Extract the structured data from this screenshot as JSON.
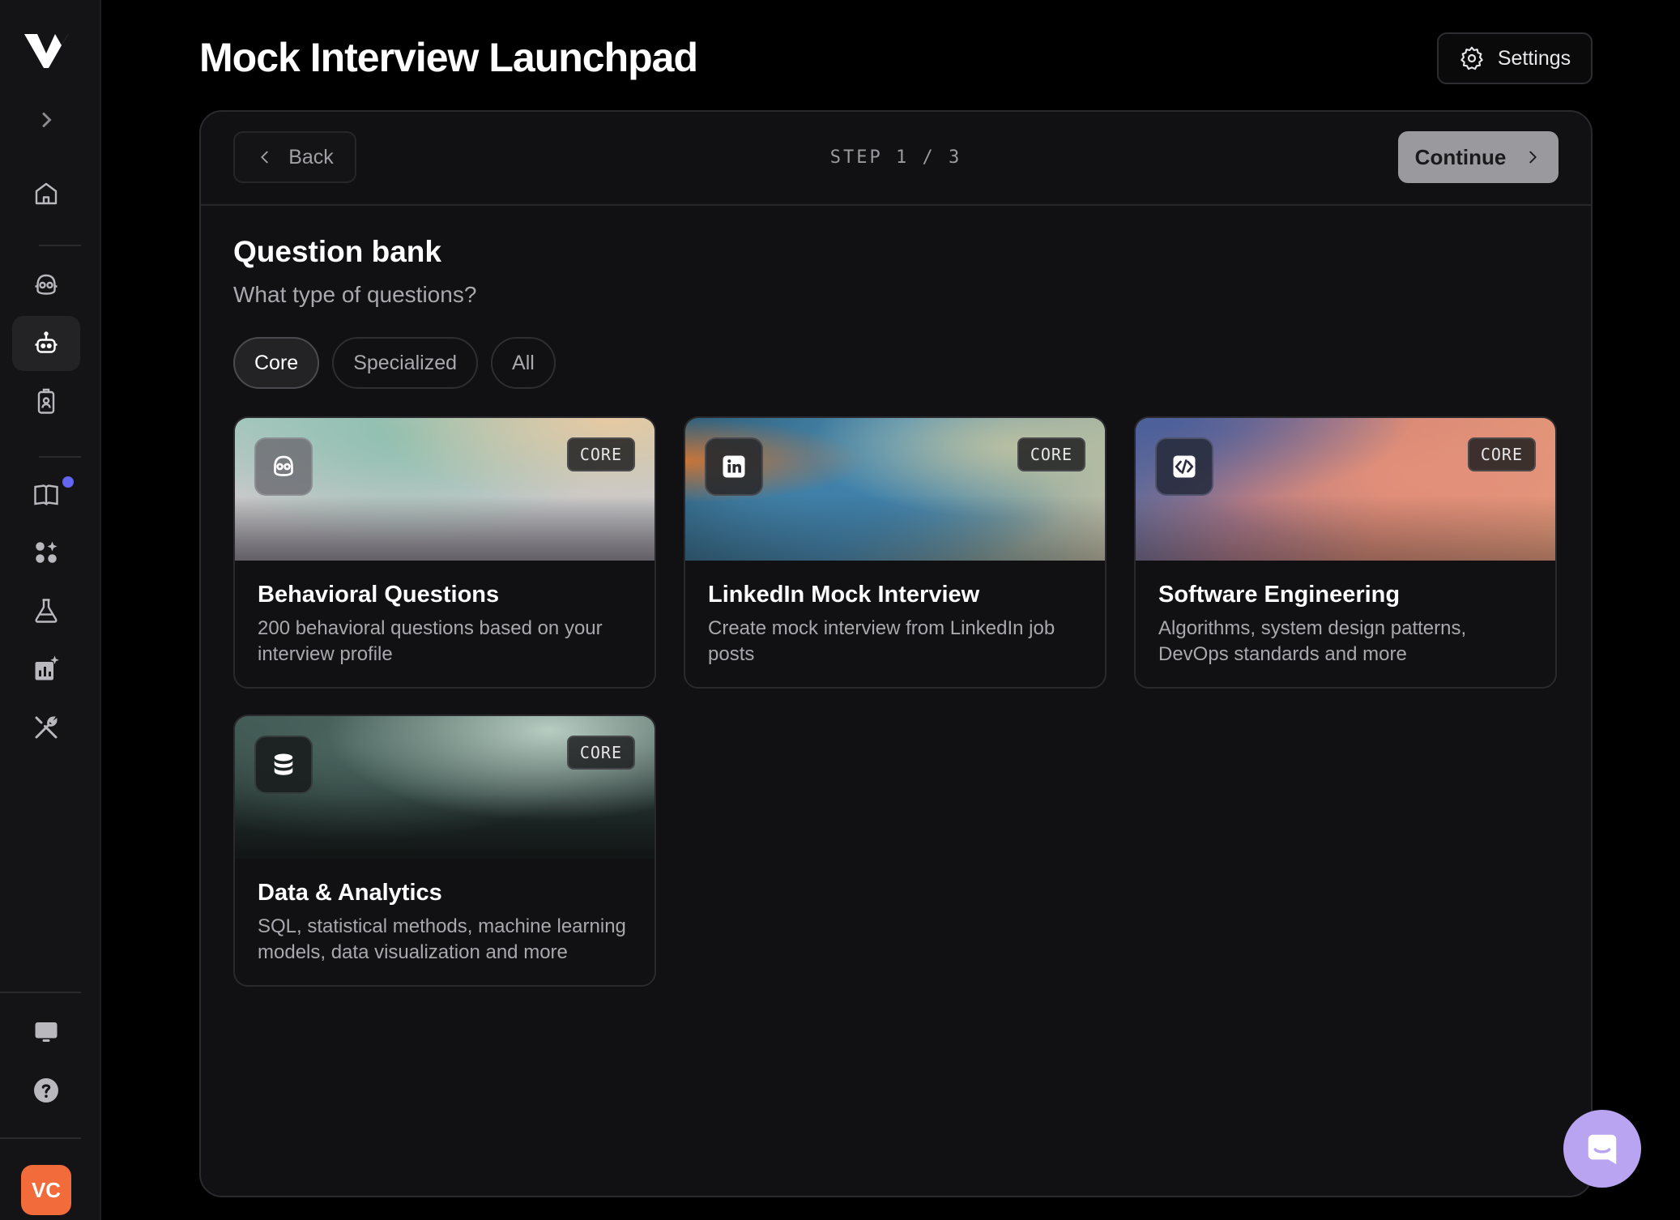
{
  "app": {
    "logo": "V-logo",
    "avatar_initials": "VC",
    "colors": {
      "accent": "#6366f1",
      "avatar": "#f26b3a",
      "chat_fab": "#b9a4f2"
    }
  },
  "sidebar": {
    "items": [
      {
        "name": "expand",
        "icon": "chevron-right-icon"
      },
      {
        "name": "home",
        "icon": "home-icon"
      },
      {
        "name": "interview-copilot",
        "icon": "copilot-icon"
      },
      {
        "name": "mock-interview",
        "icon": "robot-icon",
        "active": true
      },
      {
        "name": "resume",
        "icon": "id-badge-icon"
      },
      {
        "name": "question-bank",
        "icon": "book-icon",
        "notification": true
      },
      {
        "name": "apps",
        "icon": "apps-icon"
      },
      {
        "name": "labs",
        "icon": "flask-icon"
      },
      {
        "name": "analytics",
        "icon": "chart-icon"
      },
      {
        "name": "tools",
        "icon": "tools-icon"
      },
      {
        "name": "desktop",
        "icon": "monitor-icon"
      },
      {
        "name": "help",
        "icon": "help-icon"
      }
    ]
  },
  "header": {
    "title": "Mock Interview Launchpad",
    "settings_label": "Settings"
  },
  "wizard": {
    "back_label": "Back",
    "step_text": "STEP 1 / 3",
    "continue_label": "Continue"
  },
  "section": {
    "title": "Question bank",
    "subtitle": "What type of questions?"
  },
  "filters": [
    {
      "label": "Core",
      "active": true
    },
    {
      "label": "Specialized",
      "active": false
    },
    {
      "label": "All",
      "active": false
    }
  ],
  "cards": [
    {
      "title": "Behavioral Questions",
      "description": "200 behavioral questions based on your interview profile",
      "badge": "CORE",
      "icon": "copilot-icon"
    },
    {
      "title": "LinkedIn Mock Interview",
      "description": "Create mock interview from LinkedIn job posts",
      "badge": "CORE",
      "icon": "linkedin-icon"
    },
    {
      "title": "Software Engineering",
      "description": "Algorithms, system design patterns, DevOps standards and more",
      "badge": "CORE",
      "icon": "code-icon"
    },
    {
      "title": "Data & Analytics",
      "description": "SQL, statistical methods, machine learning models, data visualization and more",
      "badge": "CORE",
      "icon": "database-icon"
    }
  ]
}
